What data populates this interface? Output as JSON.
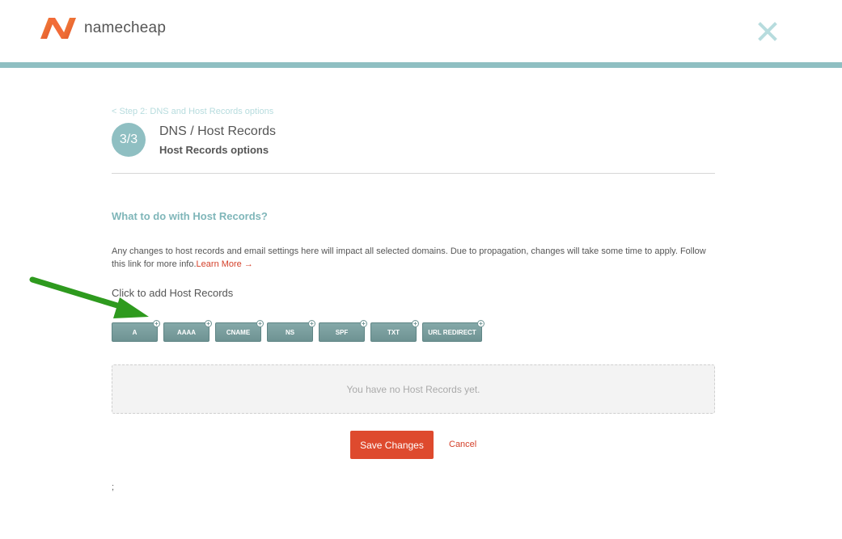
{
  "header": {
    "brand": "namecheap",
    "brand_color": "#f26b38",
    "bar_color": "#8fbfc2",
    "close_icon": "close-icon"
  },
  "wizard": {
    "back_link": "< Step 2: DNS and Host Records options",
    "step_badge": "3/3",
    "title": "DNS / Host Records",
    "subtitle": "Host Records options"
  },
  "section": {
    "title": "What to do with Host Records?",
    "info_text": "Any changes to host records and email settings here will impact all selected domains. Due to propagation, changes will take some time to apply. Follow this link for more info.",
    "learn_more": "Learn More →",
    "click_label": "Click to add Host Records"
  },
  "record_types": [
    {
      "label": "A"
    },
    {
      "label": "AAAA"
    },
    {
      "label": "CNAME"
    },
    {
      "label": "NS"
    },
    {
      "label": "SPF"
    },
    {
      "label": "TXT"
    },
    {
      "label": "URL REDIRECT"
    }
  ],
  "empty_state": "You have no Host Records yet.",
  "actions": {
    "save": "Save Changes",
    "cancel": "Cancel"
  },
  "stray_text": ";",
  "colors": {
    "accent": "#8fbfc2",
    "primary_button": "#de4a2e",
    "record_button": "#6e9393",
    "annotation_arrow": "#2e9a1e"
  }
}
